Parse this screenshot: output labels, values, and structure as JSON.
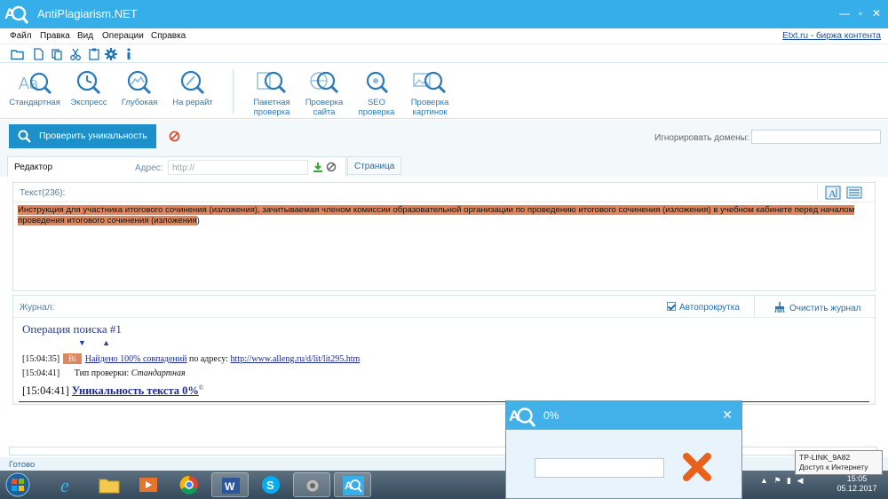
{
  "window": {
    "title": "AntiPlagiarism.NET"
  },
  "menu": {
    "items": [
      "Файл",
      "Правка",
      "Вид",
      "Операции",
      "Справка"
    ],
    "etxt_link": "Etxt.ru - биржа контента"
  },
  "icons": [
    "folder-open-icon",
    "new-file-icon",
    "copy-icon",
    "cut-icon",
    "gear-icon",
    "info-icon"
  ],
  "ribbon": {
    "standard": "Стандартная",
    "express": "Экспресс",
    "deep": "Глубокая",
    "rewrite": "На рерайт",
    "batch_1": "Пакетная",
    "batch_2": "проверка",
    "site_1": "Проверка",
    "site_2": "сайта",
    "seo_1": "SEO",
    "seo_2": "проверка",
    "images_1": "Проверка",
    "images_2": "картинок"
  },
  "actions": {
    "check_button": "Проверить уникальность",
    "ignore_domains_label": "Игнорировать домены:"
  },
  "tabs": {
    "editor": "Редактор",
    "address_label": "Адрес:",
    "address_placeholder": "http://",
    "page": "Страница"
  },
  "editor": {
    "title": "Текст(236):",
    "text_highlighted": "Инструкция для участника итогового сочинения (изложения), зачитываемая членом комиссии образовательной организации по проведению итогового сочинения (изложения) в учебном кабинете перед началом проведения итогового сочинения (изложения",
    "text_tail": ")"
  },
  "journal": {
    "title": "Журнал:",
    "autoscroll": "Автопрокрутка",
    "clear": "Очистить журнал",
    "operation_title": "Операция поиска #1",
    "arrows": "▼ ▲",
    "line1_time": "[15:04:35]",
    "line1_badge": "Bi",
    "line1_link": "Найдено 100% совпадений",
    "line1_text": " по адресу: ",
    "line1_url": "http://www.alleng.ru/d/lit/lit295.htm",
    "line2_time": "[15:04:41]",
    "line2_label": "Тип проверки: ",
    "line2_value": "Стандартная",
    "line3_time": "[15:04:41]",
    "line3_link": "Уникальность текста 0%",
    "line3_sup": "©"
  },
  "status": {
    "text": "Готово"
  },
  "dialog": {
    "title": "0%",
    "close": "✕"
  },
  "tooltip": {
    "line1": "TP-LINK_9A82",
    "line2": "Доступ к Интернету"
  },
  "clock": {
    "time": "15:05",
    "date": "05.12.2017"
  },
  "colors": {
    "accent": "#35aee9",
    "button": "#1d8fc9",
    "highlight": "#e1855a"
  }
}
